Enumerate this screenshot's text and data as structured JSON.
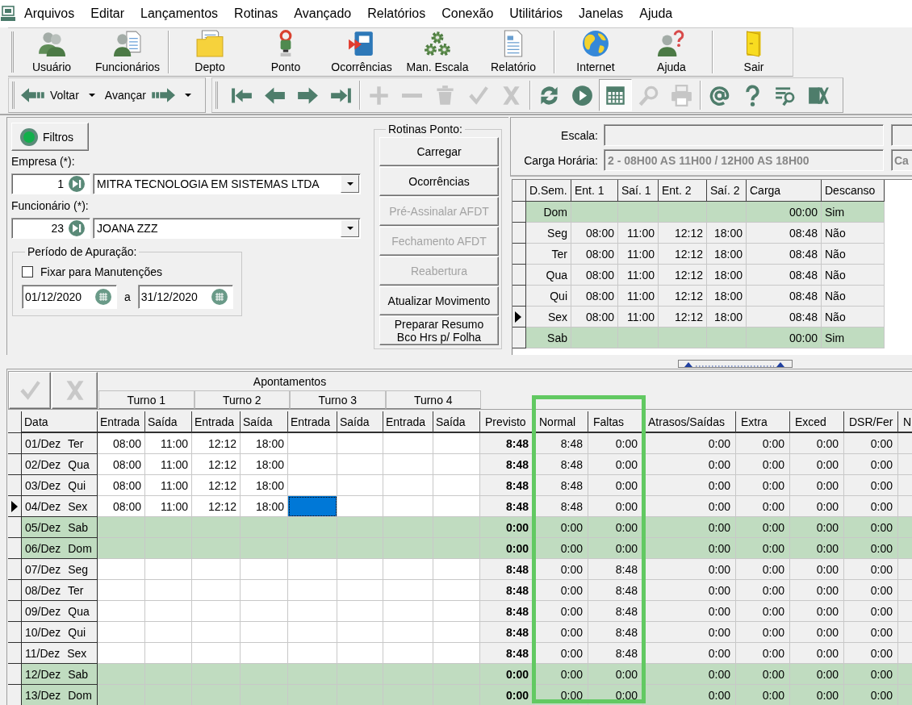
{
  "menu": [
    "Arquivos",
    "Editar",
    "Lançamentos",
    "Rotinas",
    "Avançado",
    "Relatórios",
    "Conexão",
    "Utilitários",
    "Janelas",
    "Ajuda"
  ],
  "toolbar": [
    [
      "Usuário",
      "Funcionários"
    ],
    [
      "Depto",
      "Ponto",
      "Ocorrências",
      "Man. Escala",
      "Relatório"
    ],
    [
      "Internet",
      "Ajuda"
    ],
    [
      "Sair"
    ]
  ],
  "navigation": [
    "Voltar",
    "Avançar"
  ],
  "tool_buttons": [
    [
      {
        "disabled": false,
        "pressed": false
      },
      {
        "disabled": false,
        "pressed": false
      },
      {
        "disabled": false,
        "pressed": false
      },
      {
        "disabled": false,
        "pressed": false
      }
    ],
    [
      {
        "disabled": true,
        "pressed": false
      },
      {
        "disabled": true,
        "pressed": false
      },
      {
        "disabled": true,
        "pressed": false
      },
      {
        "disabled": true,
        "pressed": false
      },
      {
        "disabled": true,
        "pressed": false
      }
    ],
    [
      {
        "disabled": false,
        "pressed": false
      },
      {
        "disabled": false,
        "pressed": false
      },
      {
        "disabled": false,
        "pressed": true
      },
      {
        "disabled": true,
        "pressed": false
      },
      {
        "disabled": true,
        "pressed": false
      }
    ],
    [
      {
        "disabled": false,
        "pressed": false
      },
      {
        "disabled": false,
        "pressed": false
      },
      {
        "disabled": false,
        "pressed": false
      },
      {
        "disabled": false,
        "pressed": false
      }
    ]
  ],
  "filters": {
    "button": "Filtros",
    "empresa": {
      "label": "Empresa (*):",
      "code": "1",
      "name": "MITRA TECNOLOGIA EM SISTEMAS LTDA"
    },
    "funcionario": {
      "label": "Funcionário (*):",
      "code": "23",
      "name": "JOANA ZZZ"
    },
    "periodo": {
      "title": "Período de Apuração:",
      "fixar": {
        "label": "Fixar para Manutenções",
        "checked": false
      },
      "start": "01/12/2020",
      "separator": "a",
      "end": "31/12/2020"
    }
  },
  "rotinas": {
    "title": "Rotinas Ponto:",
    "buttons": [
      {
        "lines": [
          "Carregar"
        ],
        "disabled": false
      },
      {
        "lines": [
          "Ocorrências"
        ],
        "disabled": false
      },
      {
        "lines": [
          "Pré-Assinalar AFDT"
        ],
        "disabled": true
      },
      {
        "lines": [
          "Fechamento AFDT"
        ],
        "disabled": true
      },
      {
        "lines": [
          "Reabertura"
        ],
        "disabled": true
      },
      {
        "lines": [
          "Atualizar Movimento"
        ],
        "disabled": false
      },
      {
        "lines": [
          "Preparar Resumo",
          "Bco Hrs p/ Folha"
        ],
        "disabled": false
      }
    ]
  },
  "schedule": {
    "escala": {
      "label": "Escala:",
      "disabled": true
    },
    "carga_horaria": {
      "label": "Carga Horária:",
      "value": "2 - 08H00 AS 11H00 / 12H00 AS 18H00",
      "disabled": true,
      "side_value": "Ca"
    },
    "columns": [
      "D.Sem.",
      "Ent. 1",
      "Saí. 1",
      "Ent. 2",
      "Saí. 2",
      "Carga",
      "Descanso"
    ],
    "rows": [
      {
        "day": "Dom",
        "carga": "00:00",
        "descanso": "Sim",
        "rest_day": true,
        "selected": false
      },
      {
        "day": "Seg",
        "times": [
          "08:00",
          "11:00",
          "12:12",
          "18:00"
        ],
        "carga": "08:48",
        "descanso": "Não",
        "rest_day": false,
        "selected": false
      },
      {
        "day": "Ter",
        "times": [
          "08:00",
          "11:00",
          "12:12",
          "18:00"
        ],
        "carga": "08:48",
        "descanso": "Não",
        "rest_day": false,
        "selected": false
      },
      {
        "day": "Qua",
        "times": [
          "08:00",
          "11:00",
          "12:12",
          "18:00"
        ],
        "carga": "08:48",
        "descanso": "Não",
        "rest_day": false,
        "selected": false
      },
      {
        "day": "Qui",
        "times": [
          "08:00",
          "11:00",
          "12:12",
          "18:00"
        ],
        "carga": "08:48",
        "descanso": "Não",
        "rest_day": false,
        "selected": false
      },
      {
        "day": "Sex",
        "times": [
          "08:00",
          "11:00",
          "12:12",
          "18:00"
        ],
        "carga": "08:48",
        "descanso": "Não",
        "rest_day": false,
        "selected": true
      },
      {
        "day": "Sab",
        "carga": "00:00",
        "descanso": "Sim",
        "rest_day": true,
        "selected": false
      }
    ]
  },
  "timesheet": {
    "buttons": [
      {
        "disabled": true
      },
      {
        "disabled": true
      }
    ],
    "group": {
      "title": "Apontamentos",
      "turnos": [
        "Turno 1",
        "Turno 2",
        "Turno 3",
        "Turno 4"
      ]
    },
    "columns": {
      "data": "Data",
      "punches": [
        "Entrada",
        "Saída",
        "Entrada",
        "Saída",
        "Entrada",
        "Saída",
        "Entrada",
        "Saída"
      ]
    },
    "summary_columns": [
      {
        "label": "Previsto",
        "highlighted": false
      },
      {
        "label": "Normal",
        "highlighted": true
      },
      {
        "label": "Faltas",
        "highlighted": true
      },
      {
        "label": "Atrasos/Saídas",
        "highlighted": false
      },
      {
        "label": "Extra",
        "highlighted": false
      },
      {
        "label": "Exced",
        "highlighted": false
      },
      {
        "label": "DSR/Fer",
        "highlighted": false
      },
      {
        "label": "N",
        "highlighted": false
      }
    ],
    "rows": [
      {
        "date": "01/Dez Ter",
        "rest_day": false,
        "selected": false,
        "punches": [
          {
            "time": "08:00",
            "selected": false
          },
          {
            "time": "11:00",
            "selected": false
          },
          {
            "time": "12:12",
            "selected": false
          },
          {
            "time": "18:00",
            "selected": false
          },
          {
            "selected": false
          },
          {
            "selected": false
          },
          {
            "selected": false
          },
          {
            "selected": false
          }
        ],
        "totals": [
          "8:48",
          "8:48",
          "0:00",
          "0:00",
          "0:00",
          "0:00",
          "0:00"
        ]
      },
      {
        "date": "02/Dez Qua",
        "rest_day": false,
        "selected": false,
        "punches": [
          {
            "time": "08:00",
            "selected": false
          },
          {
            "time": "11:00",
            "selected": false
          },
          {
            "time": "12:12",
            "selected": false
          },
          {
            "time": "18:00",
            "selected": false
          },
          {
            "selected": false
          },
          {
            "selected": false
          },
          {
            "selected": false
          },
          {
            "selected": false
          }
        ],
        "totals": [
          "8:48",
          "8:48",
          "0:00",
          "0:00",
          "0:00",
          "0:00",
          "0:00"
        ]
      },
      {
        "date": "03/Dez Qui",
        "rest_day": false,
        "selected": false,
        "punches": [
          {
            "time": "08:00",
            "selected": false
          },
          {
            "time": "11:00",
            "selected": false
          },
          {
            "time": "12:12",
            "selected": false
          },
          {
            "time": "18:00",
            "selected": false
          },
          {
            "selected": false
          },
          {
            "selected": false
          },
          {
            "selected": false
          },
          {
            "selected": false
          }
        ],
        "totals": [
          "8:48",
          "8:48",
          "0:00",
          "0:00",
          "0:00",
          "0:00",
          "0:00"
        ]
      },
      {
        "date": "04/Dez Sex",
        "rest_day": false,
        "selected": true,
        "punches": [
          {
            "time": "08:00",
            "selected": false
          },
          {
            "time": "11:00",
            "selected": false
          },
          {
            "time": "12:12",
            "selected": false
          },
          {
            "time": "18:00",
            "selected": false
          },
          {
            "selected": true
          },
          {
            "selected": false
          },
          {
            "selected": false
          },
          {
            "selected": false
          }
        ],
        "totals": [
          "8:48",
          "8:48",
          "0:00",
          "0:00",
          "0:00",
          "0:00",
          "0:00"
        ]
      },
      {
        "date": "05/Dez Sab",
        "rest_day": true,
        "selected": false,
        "punches": [
          {
            "selected": false
          },
          {
            "selected": false
          },
          {
            "selected": false
          },
          {
            "selected": false
          },
          {
            "selected": false
          },
          {
            "selected": false
          },
          {
            "selected": false
          },
          {
            "selected": false
          }
        ],
        "totals": [
          "0:00",
          "0:00",
          "0:00",
          "0:00",
          "0:00",
          "0:00",
          "0:00"
        ]
      },
      {
        "date": "06/Dez Dom",
        "rest_day": true,
        "selected": false,
        "punches": [
          {
            "selected": false
          },
          {
            "selected": false
          },
          {
            "selected": false
          },
          {
            "selected": false
          },
          {
            "selected": false
          },
          {
            "selected": false
          },
          {
            "selected": false
          },
          {
            "selected": false
          }
        ],
        "totals": [
          "0:00",
          "0:00",
          "0:00",
          "0:00",
          "0:00",
          "0:00",
          "0:00"
        ]
      },
      {
        "date": "07/Dez Seg",
        "rest_day": false,
        "selected": false,
        "punches": [
          {
            "selected": false
          },
          {
            "selected": false
          },
          {
            "selected": false
          },
          {
            "selected": false
          },
          {
            "selected": false
          },
          {
            "selected": false
          },
          {
            "selected": false
          },
          {
            "selected": false
          }
        ],
        "totals": [
          "8:48",
          "0:00",
          "8:48",
          "0:00",
          "0:00",
          "0:00",
          "0:00"
        ]
      },
      {
        "date": "08/Dez Ter",
        "rest_day": false,
        "selected": false,
        "punches": [
          {
            "selected": false
          },
          {
            "selected": false
          },
          {
            "selected": false
          },
          {
            "selected": false
          },
          {
            "selected": false
          },
          {
            "selected": false
          },
          {
            "selected": false
          },
          {
            "selected": false
          }
        ],
        "totals": [
          "8:48",
          "0:00",
          "8:48",
          "0:00",
          "0:00",
          "0:00",
          "0:00"
        ]
      },
      {
        "date": "09/Dez Qua",
        "rest_day": false,
        "selected": false,
        "punches": [
          {
            "selected": false
          },
          {
            "selected": false
          },
          {
            "selected": false
          },
          {
            "selected": false
          },
          {
            "selected": false
          },
          {
            "selected": false
          },
          {
            "selected": false
          },
          {
            "selected": false
          }
        ],
        "totals": [
          "8:48",
          "0:00",
          "8:48",
          "0:00",
          "0:00",
          "0:00",
          "0:00"
        ]
      },
      {
        "date": "10/Dez Qui",
        "rest_day": false,
        "selected": false,
        "punches": [
          {
            "selected": false
          },
          {
            "selected": false
          },
          {
            "selected": false
          },
          {
            "selected": false
          },
          {
            "selected": false
          },
          {
            "selected": false
          },
          {
            "selected": false
          },
          {
            "selected": false
          }
        ],
        "totals": [
          "8:48",
          "0:00",
          "8:48",
          "0:00",
          "0:00",
          "0:00",
          "0:00"
        ]
      },
      {
        "date": "11/Dez Sex",
        "rest_day": false,
        "selected": false,
        "punches": [
          {
            "selected": false
          },
          {
            "selected": false
          },
          {
            "selected": false
          },
          {
            "selected": false
          },
          {
            "selected": false
          },
          {
            "selected": false
          },
          {
            "selected": false
          },
          {
            "selected": false
          }
        ],
        "totals": [
          "8:48",
          "0:00",
          "8:48",
          "0:00",
          "0:00",
          "0:00",
          "0:00"
        ]
      },
      {
        "date": "12/Dez Sab",
        "rest_day": true,
        "selected": false,
        "punches": [
          {
            "selected": false
          },
          {
            "selected": false
          },
          {
            "selected": false
          },
          {
            "selected": false
          },
          {
            "selected": false
          },
          {
            "selected": false
          },
          {
            "selected": false
          },
          {
            "selected": false
          }
        ],
        "totals": [
          "0:00",
          "0:00",
          "0:00",
          "0:00",
          "0:00",
          "0:00",
          "0:00"
        ]
      },
      {
        "date": "13/Dez Dom",
        "rest_day": true,
        "selected": false,
        "punches": [
          {
            "selected": false
          },
          {
            "selected": false
          },
          {
            "selected": false
          },
          {
            "selected": false
          },
          {
            "selected": false
          },
          {
            "selected": false
          },
          {
            "selected": false
          },
          {
            "selected": false
          }
        ],
        "totals": [
          "0:00",
          "0:00",
          "0:00",
          "0:00",
          "0:00",
          "0:00",
          "0:00"
        ]
      }
    ]
  }
}
